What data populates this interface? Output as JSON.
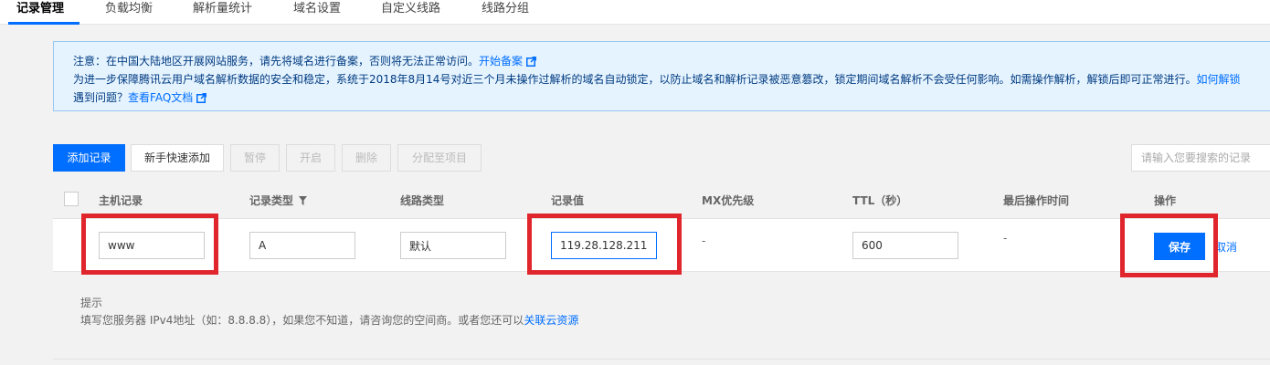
{
  "tabs": [
    {
      "label": "记录管理"
    },
    {
      "label": "负载均衡"
    },
    {
      "label": "解析量统计"
    },
    {
      "label": "域名设置"
    },
    {
      "label": "自定义线路"
    },
    {
      "label": "线路分组"
    }
  ],
  "notice": {
    "line1": "注意：在中国大陆地区开展网站服务，请先将域名进行备案，否则将无法正常访问。",
    "line1_link": "开始备案",
    "line2": "为进一步保障腾讯云用户域名解析数据的安全和稳定，系统于2018年8月14号对近三个月未操作过解析的域名自动锁定，以防止域名和解析记录被恶意篡改，锁定期间域名解析不会受任何影响。如需操作解析，解锁后即可正常进行。",
    "line2_link": "如何解锁",
    "line3_prefix": "遇到问题？",
    "line3_link": "查看FAQ文档"
  },
  "toolbar": {
    "add": "添加记录",
    "quick_add": "新手快速添加",
    "pause": "暂停",
    "enable": "开启",
    "delete": "删除",
    "assign": "分配至项目",
    "search_placeholder": "请输入您要搜索的记录"
  },
  "table": {
    "headers": {
      "host": "主机记录",
      "type": "记录类型",
      "line": "线路类型",
      "value": "记录值",
      "mx": "MX优先级",
      "ttl": "TTL（秒）",
      "last_op": "最后操作时间",
      "ops": "操作"
    },
    "row": {
      "host": "www",
      "type": "A",
      "line": "默认",
      "value": "119.28.128.211",
      "mx": "-",
      "ttl": "600",
      "last_op": "-",
      "save": "保存",
      "cancel": "取消"
    }
  },
  "hint": {
    "title": "提示",
    "text": "填写您服务器 IPv4地址（如：8.8.8.8），如果您不知道，请咨询您的空间商。或者您还可以",
    "link": "关联云资源"
  },
  "colors": {
    "accent": "#006eff",
    "highlight": "#e0262c",
    "notice_bg": "#e5f3ff"
  }
}
